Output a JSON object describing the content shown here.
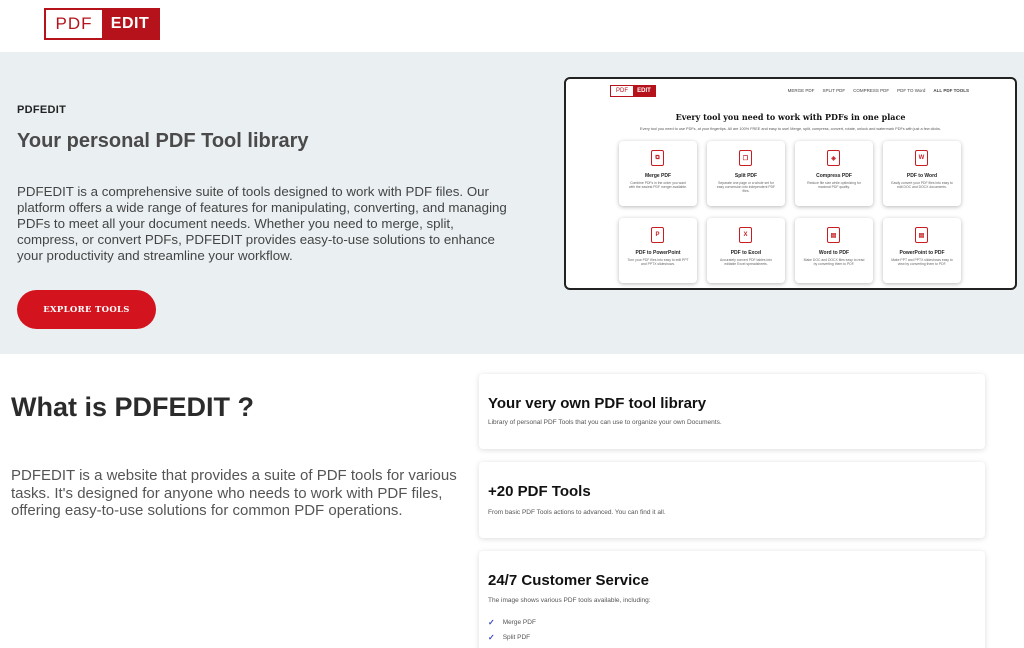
{
  "brand": {
    "part1": "PDF",
    "part2": "EDIT"
  },
  "hero": {
    "eyebrow": "PDFEDIT",
    "title": "Your personal PDF Tool library",
    "description": "PDFEDIT is a comprehensive suite of tools designed to work with PDF files. Our platform offers a wide range of features for manipulating, converting, and managing PDFs to meet all your document needs. Whether you need to merge, split, compress, or convert PDFs, PDFEDIT provides easy-to-use solutions to enhance your productivity and streamline your workflow.",
    "cta_label": "EXPLORE TOOLS",
    "cta_color": "#d3141f"
  },
  "preview": {
    "logo_part1": "PDF",
    "logo_part2": "EDIT",
    "nav": [
      "MERGE PDF",
      "SPLIT PDF",
      "COMPRESS PDF",
      "PDF TO Word",
      "ALL PDF TOOLS"
    ],
    "title": "Every tool you need to work with PDFs in one place",
    "subtitle": "Every tool you need to use PDFs, at your fingertips. All are 100% FREE and easy to use! Merge, split, compress, convert, rotate, unlock and watermark PDFs with just a few clicks.",
    "tools": [
      {
        "name": "Merge PDF",
        "desc": "Combine PDFs in the order you want with the easiest PDF merger available.",
        "icon": "merge-icon"
      },
      {
        "name": "Split PDF",
        "desc": "Separate one page or a whole set for easy conversion into independent PDF files.",
        "icon": "split-icon"
      },
      {
        "name": "Compress PDF",
        "desc": "Reduce file size while optimizing for maximal PDF quality.",
        "icon": "compress-icon"
      },
      {
        "name": "PDF to Word",
        "desc": "Easily convert your PDF files into easy to edit DOC and DOCX documents.",
        "icon": "word-icon"
      },
      {
        "name": "PDF to PowerPoint",
        "desc": "Turn your PDF files into easy to edit PPT and PPTX slideshows.",
        "icon": "powerpoint-icon"
      },
      {
        "name": "PDF to Excel",
        "desc": "Accurately convert PDF tables into editable Excel spreadsheets.",
        "icon": "excel-icon"
      },
      {
        "name": "Word to PDF",
        "desc": "Make DOC and DOCX files easy to read by converting them to PDF.",
        "icon": "pdf-icon"
      },
      {
        "name": "PowerPoint to PDF",
        "desc": "Make PPT and PPTX slideshows easy to view by converting them to PDF.",
        "icon": "pdf-icon"
      }
    ]
  },
  "what": {
    "title": "What is PDFEDIT ?",
    "description": "PDFEDIT is a website that provides a suite of PDF tools for various tasks. It's designed for anyone who needs to work with PDF files, offering easy-to-use solutions for common PDF operations."
  },
  "features": [
    {
      "title": "Your very own PDF tool library",
      "text": "Library of personal PDF Tools that you can use to organize your own Documents."
    },
    {
      "title": "+20 PDF Tools",
      "text": "From basic PDF Tools actions to advanced. You can find it all."
    },
    {
      "title": "24/7 Customer Service",
      "text": "The image shows various PDF tools available, including:",
      "items": [
        "Merge PDF",
        "Split PDF"
      ]
    }
  ]
}
